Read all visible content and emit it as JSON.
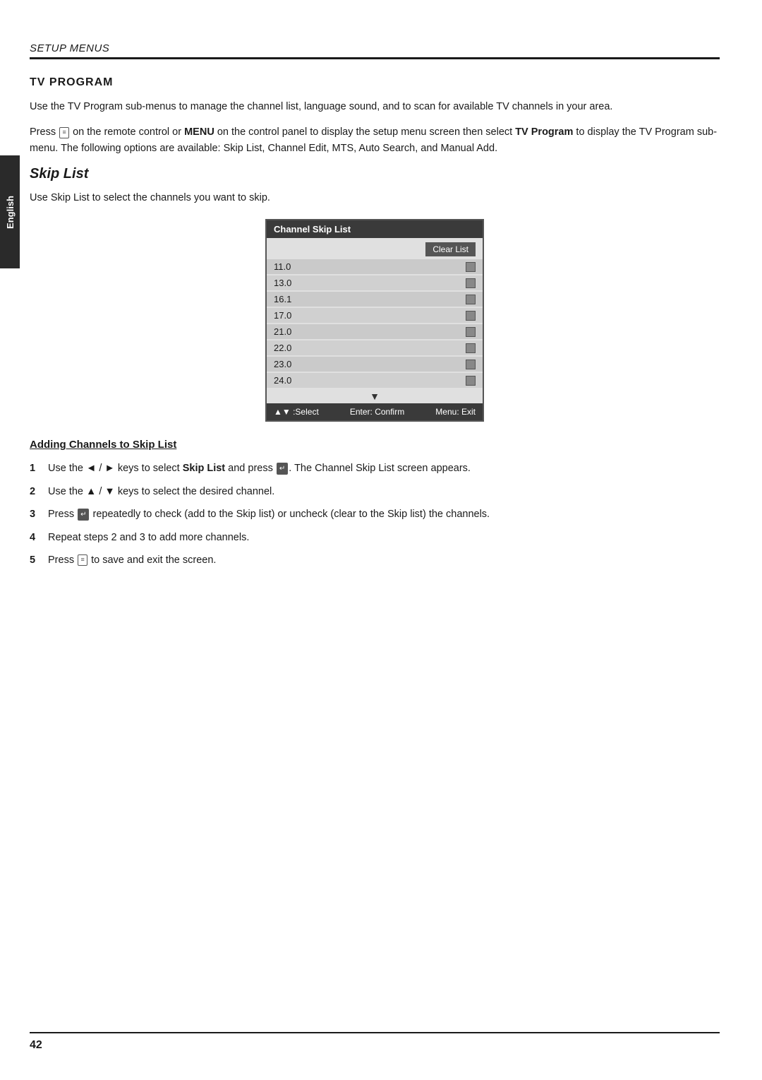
{
  "sidebar": {
    "label": "English"
  },
  "header": {
    "section_title": "SETUP MENUS"
  },
  "tv_program": {
    "heading": "TV PROGRAM",
    "paragraph1": "Use the TV Program sub-menus to manage the channel list, language sound, and to scan for available TV channels in your area.",
    "paragraph2_prefix": "Press",
    "paragraph2_mid": " on the remote control or ",
    "paragraph2_menu": "MENU",
    "paragraph2_suffix": " on the control panel to display the setup menu screen then select ",
    "paragraph2_tv": "TV Program",
    "paragraph2_end": " to display the TV Program sub-menu. The following options are available: Skip List, Channel Edit, MTS, Auto Search, and Manual Add."
  },
  "skip_list": {
    "heading": "Skip List",
    "description": "Use Skip List to select the channels you want to skip.",
    "channel_skip_list": {
      "title": "Channel Skip List",
      "clear_list_btn": "Clear List",
      "channels": [
        "11.0",
        "13.0",
        "16.1",
        "17.0",
        "21.0",
        "22.0",
        "23.0",
        "24.0"
      ],
      "nav_bar": {
        "select": "▲▼  :Select",
        "confirm": "Enter: Confirm",
        "exit": "Menu: Exit"
      }
    }
  },
  "adding_channels": {
    "heading": "Adding Channels to Skip List",
    "steps": [
      {
        "num": "1",
        "text_pre": "Use the ◄ / ► keys to select ",
        "bold": "Skip List",
        "text_post": " and press",
        "enter_icon": true,
        "text_end": ". The Channel Skip List screen appears."
      },
      {
        "num": "2",
        "text_pre": "Use the ▲ / ▼ keys to select the desired channel."
      },
      {
        "num": "3",
        "text_pre": "Press",
        "enter_icon": true,
        "text_end": " repeatedly to check (add to the Skip list) or uncheck (clear to the Skip list) the channels."
      },
      {
        "num": "4",
        "text_pre": "Repeat steps 2 and 3 to add more channels."
      },
      {
        "num": "5",
        "text_pre": "Press",
        "remote_icon": true,
        "text_end": " to save and exit the screen."
      }
    ]
  },
  "page_number": "42"
}
